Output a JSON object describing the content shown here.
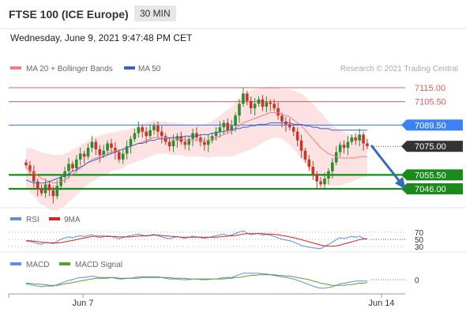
{
  "header": {
    "title": "FTSE 100 (ICE Europe)",
    "interval": "30 MIN",
    "datetime": "Wednesday, June 9, 2021 9:47:48 PM CET"
  },
  "legend": {
    "bollinger": "MA 20 + Bollinger Bands",
    "ma50": "MA 50",
    "credit": "Research © 2021 Trading Central",
    "rsi": "RSI",
    "rsi_ma": "9MA",
    "macd": "MACD",
    "macd_signal": "MACD Signal"
  },
  "colors": {
    "bollinger": "#f08080",
    "band_fill": "#fbd8d8",
    "ma50": "#3e63b8",
    "resistance": "#e35a5a",
    "pivot": "#3b82f6",
    "support": "#1a8a1a",
    "last": "#333333",
    "up": "#2e8b2e",
    "down": "#c0392b",
    "rsi": "#5b8ee6",
    "rsi_ma": "#e22020",
    "macd": "#5b8ee6",
    "macd_signal": "#5aa02c",
    "arrow": "#2f6db5"
  },
  "chart_data": [
    {
      "type": "candlestick",
      "title": "FTSE 100 (ICE Europe)",
      "interval": "30 MIN",
      "y_range": [
        7035,
        7125
      ],
      "x_ticks": [
        "Jun 7",
        "Jun 14"
      ],
      "levels": [
        {
          "label": "7115.00",
          "value": 7115.0,
          "kind": "resistance"
        },
        {
          "label": "7105.50",
          "value": 7105.5,
          "kind": "resistance"
        },
        {
          "label": "7089.50",
          "value": 7089.5,
          "kind": "pivot"
        },
        {
          "label": "7075.00",
          "value": 7075.0,
          "kind": "last"
        },
        {
          "label": "7055.50",
          "value": 7055.5,
          "kind": "support"
        },
        {
          "label": "7046.00",
          "value": 7046.0,
          "kind": "support"
        }
      ],
      "closes": [
        7062,
        7058,
        7051,
        7046,
        7043,
        7049,
        7045,
        7041,
        7048,
        7054,
        7058,
        7063,
        7060,
        7066,
        7070,
        7068,
        7074,
        7078,
        7073,
        7069,
        7072,
        7077,
        7074,
        7071,
        7066,
        7070,
        7075,
        7080,
        7084,
        7088,
        7085,
        7082,
        7086,
        7089,
        7085,
        7082,
        7078,
        7075,
        7079,
        7082,
        7078,
        7076,
        7080,
        7084,
        7081,
        7078,
        7076,
        7079,
        7082,
        7085,
        7088,
        7091,
        7086,
        7089,
        7096,
        7104,
        7111,
        7106,
        7101,
        7104,
        7107,
        7102,
        7105,
        7104,
        7101,
        7096,
        7092,
        7090,
        7088,
        7085,
        7079,
        7072,
        7066,
        7061,
        7056,
        7051,
        7049,
        7053,
        7058,
        7064,
        7071,
        7076,
        7074,
        7078,
        7081,
        7079,
        7083,
        7077,
        7075
      ],
      "ma20": [
        7060,
        7059,
        7057,
        7055,
        7053,
        7052,
        7051,
        7050,
        7050,
        7051,
        7052,
        7054,
        7056,
        7058,
        7060,
        7062,
        7064,
        7066,
        7067,
        7068,
        7069,
        7070,
        7071,
        7072,
        7072,
        7073,
        7074,
        7075,
        7076,
        7077,
        7078,
        7079,
        7080,
        7081,
        7081,
        7081,
        7081,
        7080,
        7080,
        7080,
        7080,
        7079,
        7079,
        7079,
        7079,
        7079,
        7079,
        7079,
        7080,
        7081,
        7082,
        7083,
        7084,
        7085,
        7087,
        7089,
        7091,
        7092,
        7093,
        7094,
        7095,
        7096,
        7097,
        7098,
        7098,
        7098,
        7097,
        7096,
        7095,
        7093,
        7091,
        7089,
        7086,
        7083,
        7080,
        7077,
        7074,
        7072,
        7070,
        7069,
        7068,
        7067,
        7067,
        7067,
        7067,
        7067,
        7068,
        7068,
        7068
      ],
      "ma50": [
        7052,
        7051,
        7050,
        7050,
        7050,
        7050,
        7051,
        7052,
        7053,
        7054,
        7055,
        7056,
        7058,
        7059,
        7061,
        7062,
        7064,
        7065,
        7066,
        7067,
        7068,
        7069,
        7070,
        7071,
        7072,
        7073,
        7074,
        7075,
        7076,
        7077,
        7077,
        7078,
        7079,
        7079,
        7080,
        7080,
        7080,
        7081,
        7081,
        7081,
        7081,
        7082,
        7082,
        7082,
        7082,
        7083,
        7083,
        7083,
        7084,
        7084,
        7085,
        7085,
        7086,
        7086,
        7087,
        7087,
        7088,
        7088,
        7089,
        7089,
        7090,
        7090,
        7090,
        7091,
        7091,
        7091,
        7091,
        7091,
        7091,
        7090,
        7090,
        7090,
        7089,
        7089,
        7088,
        7088,
        7087,
        7087,
        7087,
        7086,
        7086,
        7086,
        7086,
        7086,
        7086,
        7086,
        7086,
        7086,
        7086
      ],
      "band_width": [
        14,
        15,
        16,
        17,
        18,
        18,
        19,
        19,
        19,
        18,
        18,
        17,
        17,
        16,
        16,
        15,
        15,
        15,
        15,
        14,
        14,
        14,
        13,
        13,
        13,
        13,
        12,
        12,
        12,
        12,
        12,
        12,
        12,
        12,
        11,
        11,
        11,
        11,
        11,
        11,
        11,
        11,
        11,
        11,
        11,
        11,
        11,
        12,
        12,
        13,
        14,
        15,
        16,
        17,
        18,
        19,
        20,
        20,
        20,
        20,
        19,
        19,
        18,
        18,
        17,
        17,
        17,
        18,
        19,
        20,
        21,
        22,
        23,
        23,
        24,
        24,
        24,
        23,
        22,
        21,
        20,
        19,
        18,
        17,
        16,
        15,
        15,
        14,
        14
      ]
    },
    {
      "type": "line",
      "title": "RSI",
      "y_ticks": [
        "70",
        "50",
        "30"
      ],
      "y_range": [
        0,
        100
      ],
      "series": [
        {
          "name": "RSI",
          "values": [
            45,
            44,
            42,
            38,
            36,
            42,
            40,
            38,
            45,
            50,
            54,
            57,
            55,
            58,
            60,
            58,
            61,
            63,
            58,
            55,
            57,
            60,
            58,
            55,
            52,
            55,
            58,
            61,
            63,
            65,
            62,
            59,
            62,
            64,
            60,
            57,
            54,
            52,
            55,
            58,
            55,
            53,
            56,
            59,
            57,
            55,
            53,
            55,
            58,
            60,
            63,
            65,
            60,
            62,
            67,
            71,
            74,
            68,
            63,
            65,
            67,
            62,
            64,
            62,
            58,
            54,
            50,
            48,
            46,
            43,
            38,
            33,
            30,
            28,
            26,
            25,
            24,
            30,
            36,
            42,
            49,
            55,
            52,
            56,
            58,
            56,
            59,
            53,
            50
          ]
        },
        {
          "name": "9MA",
          "values": [
            46,
            46,
            45,
            44,
            42,
            41,
            40,
            40,
            40,
            41,
            43,
            45,
            47,
            49,
            52,
            54,
            56,
            58,
            59,
            59,
            59,
            58,
            58,
            58,
            57,
            57,
            57,
            57,
            58,
            59,
            60,
            61,
            61,
            62,
            62,
            61,
            60,
            59,
            58,
            57,
            56,
            56,
            56,
            56,
            56,
            56,
            56,
            56,
            56,
            56,
            57,
            58,
            59,
            60,
            61,
            63,
            65,
            66,
            66,
            66,
            66,
            66,
            65,
            65,
            64,
            63,
            61,
            59,
            57,
            55,
            52,
            49,
            46,
            43,
            40,
            37,
            34,
            32,
            31,
            31,
            32,
            34,
            37,
            40,
            43,
            46,
            49,
            51,
            52
          ]
        }
      ]
    },
    {
      "type": "line",
      "title": "MACD",
      "y_ticks": [
        "0"
      ],
      "series": [
        {
          "name": "MACD",
          "values": [
            -6,
            -7,
            -8,
            -9,
            -10,
            -9,
            -9,
            -9,
            -7,
            -5,
            -3,
            -1,
            0,
            2,
            3,
            3,
            4,
            5,
            4,
            3,
            3,
            3,
            3,
            2,
            1,
            1,
            2,
            2,
            3,
            4,
            4,
            4,
            4,
            4,
            4,
            3,
            2,
            1,
            1,
            1,
            0,
            0,
            0,
            1,
            1,
            0,
            0,
            0,
            1,
            1,
            2,
            3,
            3,
            3,
            5,
            7,
            9,
            9,
            9,
            9,
            9,
            8,
            8,
            7,
            6,
            5,
            4,
            3,
            2,
            1,
            -1,
            -3,
            -5,
            -7,
            -9,
            -11,
            -12,
            -12,
            -11,
            -10,
            -8,
            -6,
            -5,
            -4,
            -3,
            -2,
            -2,
            -2,
            -2
          ]
        },
        {
          "name": "MACD Signal",
          "values": [
            -5,
            -5,
            -6,
            -6,
            -7,
            -7,
            -8,
            -8,
            -8,
            -7,
            -6,
            -5,
            -4,
            -3,
            -2,
            -1,
            0,
            1,
            2,
            2,
            2,
            2,
            3,
            3,
            2,
            2,
            2,
            2,
            2,
            2,
            3,
            3,
            3,
            3,
            3,
            3,
            3,
            3,
            2,
            2,
            2,
            2,
            1,
            1,
            1,
            1,
            1,
            1,
            1,
            1,
            1,
            1,
            2,
            2,
            3,
            3,
            4,
            5,
            6,
            6,
            7,
            7,
            7,
            7,
            7,
            6,
            6,
            5,
            5,
            4,
            3,
            2,
            1,
            0,
            -2,
            -3,
            -5,
            -6,
            -7,
            -8,
            -8,
            -8,
            -8,
            -7,
            -7,
            -6,
            -5,
            -5,
            -4
          ]
        }
      ]
    }
  ]
}
